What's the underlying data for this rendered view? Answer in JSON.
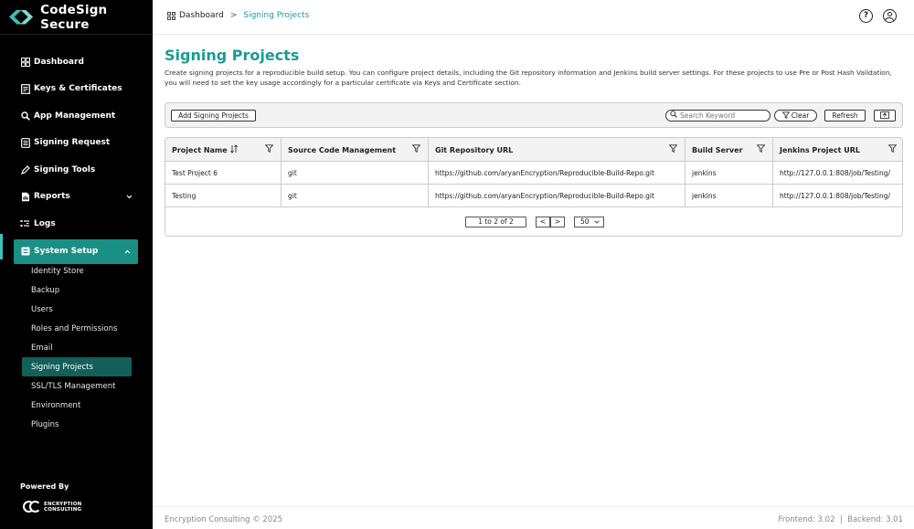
{
  "brand": {
    "name": "CodeSign Secure"
  },
  "breadcrumb": {
    "home": "Dashboard",
    "separator": ">",
    "current": "Signing Projects"
  },
  "sidebar": {
    "items": [
      {
        "label": "Dashboard",
        "icon": "grid-icon"
      },
      {
        "label": "Keys & Certificates",
        "icon": "certificate-icon"
      },
      {
        "label": "App Management",
        "icon": "search-icon"
      },
      {
        "label": "Signing Request",
        "icon": "document-icon"
      },
      {
        "label": "Signing Tools",
        "icon": "pen-icon"
      },
      {
        "label": "Reports",
        "icon": "report-icon"
      },
      {
        "label": "Logs",
        "icon": "logs-icon"
      },
      {
        "label": "System Setup",
        "icon": "settings-icon"
      }
    ],
    "sub_items": [
      "Identity Store",
      "Backup",
      "Users",
      "Roles and Permissions",
      "Email",
      "Signing Projects",
      "SSL/TLS Management",
      "Environment",
      "Plugins"
    ],
    "powered_by": "Powered By",
    "powered_logo": {
      "line1": "ENCRYPTION",
      "line2": "CONSULTING"
    }
  },
  "page": {
    "title": "Signing Projects",
    "description": "Create signing projects for a reproducible build setup. You can configure project details, including the Git repository information and Jenkins build server settings. For these projects to use Pre or Post Hash Validation, you will need to set the key usage accordingly for a particular certificate via Keys and Certificate section."
  },
  "toolbar": {
    "add_label": "Add Signing Projects",
    "search_placeholder": "Search Keyword",
    "clear_label": "Clear",
    "refresh_label": "Refresh"
  },
  "table": {
    "columns": [
      "Project Name",
      "Source Code Management",
      "Git Repository URL",
      "Build Server",
      "Jenkins Project URL"
    ],
    "rows": [
      [
        "Test Project 6",
        "git",
        "https://github.com/aryanEncryption/Reproducible-Build-Repo.git",
        "jenkins",
        "http://127.0.0.1:808/job/Testing/"
      ],
      [
        "Testing",
        "git",
        "https://github.com/aryanEncryption/Reproducible-Build-Repo.git",
        "jenkins",
        "http://127.0.0.1:808/job/Testing/"
      ]
    ]
  },
  "pagination": {
    "summary": "1 to 2 of 2",
    "prev": "<",
    "next": ">",
    "page_size": "50"
  },
  "footer": {
    "copyright": "Encryption Consulting © 2025",
    "version": "Frontend: 3.02  |  Backend: 3.01"
  },
  "colors": {
    "accent": "#1a9c92",
    "active_nav": "#1a8f86",
    "sidebar_bg": "#000000"
  }
}
